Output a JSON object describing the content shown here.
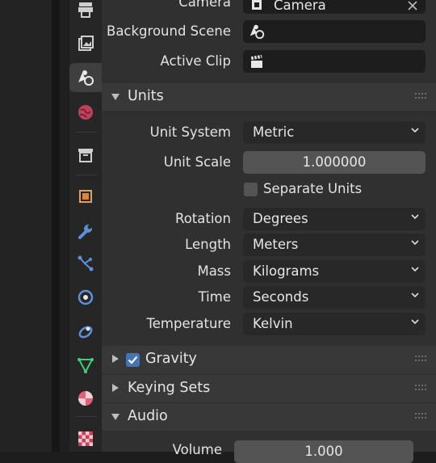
{
  "scene": {
    "camera": {
      "label": "Camera",
      "value": "Camera"
    },
    "background_scene": {
      "label": "Background Scene"
    },
    "active_clip": {
      "label": "Active Clip"
    }
  },
  "units": {
    "title": "Units",
    "unit_system": {
      "label": "Unit System",
      "value": "Metric"
    },
    "unit_scale": {
      "label": "Unit Scale",
      "value": "1.000000"
    },
    "separate_units": {
      "label": "Separate Units",
      "checked": false
    },
    "rotation": {
      "label": "Rotation",
      "value": "Degrees"
    },
    "length": {
      "label": "Length",
      "value": "Meters"
    },
    "mass": {
      "label": "Mass",
      "value": "Kilograms"
    },
    "time": {
      "label": "Time",
      "value": "Seconds"
    },
    "temperature": {
      "label": "Temperature",
      "value": "Kelvin"
    }
  },
  "sections": {
    "gravity": {
      "title": "Gravity",
      "checked": true
    },
    "keying_sets": {
      "title": "Keying Sets"
    },
    "audio": {
      "title": "Audio"
    }
  },
  "audio": {
    "volume": {
      "label": "Volume",
      "value": "1.000"
    }
  },
  "tabs": [
    "tool",
    "render",
    "output",
    "view-layer",
    "scene",
    "world",
    "collection",
    "object",
    "modifiers",
    "particles",
    "physics",
    "constraints",
    "data",
    "material",
    "texture"
  ],
  "colors": {
    "checkbox_on": "#4772b3",
    "panel": "#303030",
    "header": "#383838",
    "field": "#1d1d1d"
  }
}
